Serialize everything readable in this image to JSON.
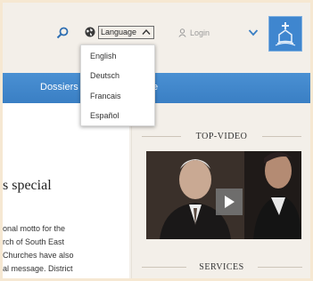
{
  "header": {
    "language_label": "Language",
    "login_label": "Login"
  },
  "language_menu": {
    "options": [
      "English",
      "Deutsch",
      "Francais",
      "Español"
    ]
  },
  "nav": {
    "items": [
      {
        "label": "Dossiers"
      },
      {
        "label": "e"
      }
    ]
  },
  "main": {
    "heading": "s special",
    "lines": [
      "onal motto for the",
      "rch of South East",
      "Churches have also",
      "al message. District"
    ]
  },
  "sidebar": {
    "top_video_title": "TOP-VIDEO",
    "services_title": "SERVICES"
  },
  "colors": {
    "nav_blue": "#3a7fc4",
    "logo_blue": "#3f86cf",
    "background": "#f3efe9",
    "outer_frame": "#f6e8d2"
  }
}
